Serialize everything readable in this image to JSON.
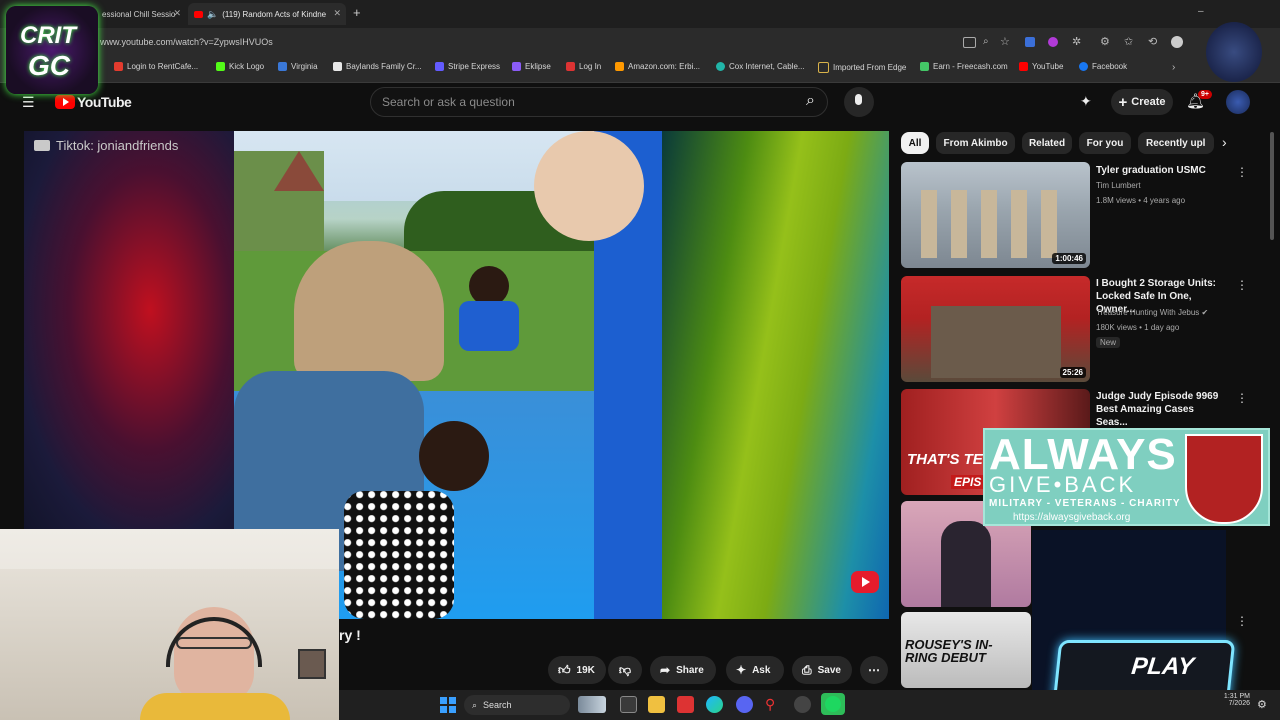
{
  "browser": {
    "tabs": [
      {
        "label": "essional Chill Sessio"
      },
      {
        "label": "(119) Random Acts of Kindne"
      }
    ],
    "new_tab": "+",
    "url": "www.youtube.com/watch?v=ZypwsIHVUOs",
    "bookmarks": [
      {
        "label": "Login to RentCafe...",
        "color": "#e33b2e"
      },
      {
        "label": "Kick Logo",
        "color": "#53fc18"
      },
      {
        "label": "Virginia",
        "color": "#3a78d8"
      },
      {
        "label": "Baylands Family Cr...",
        "color": "#e8e8e8"
      },
      {
        "label": "Stripe Express",
        "color": "#635bff"
      },
      {
        "label": "Eklipse",
        "color": "#8b5cf6"
      },
      {
        "label": "Log In",
        "color": "#d33"
      },
      {
        "label": "Amazon.com: Erbi...",
        "color": "#ff9900"
      },
      {
        "label": "Cox Internet, Cable...",
        "color": "#21b5a8"
      },
      {
        "label": "Imported From Edge",
        "color": "#d9b34a"
      },
      {
        "label": "Earn - Freecash.com",
        "color": "#44c767"
      },
      {
        "label": "YouTube",
        "color": "#ff0000"
      },
      {
        "label": "Facebook",
        "color": "#1877f2"
      }
    ]
  },
  "youtube": {
    "logo": "YouTube",
    "search_placeholder": "Search or ask a question",
    "create_label": "Create",
    "notif_count": "9+",
    "tiktok_label": "Tiktok: joniandfriends",
    "title_fragment": "ry !",
    "actions": {
      "likes": "19K",
      "share": "Share",
      "ask": "Ask",
      "save": "Save"
    }
  },
  "chips": [
    {
      "label": "All",
      "active": true
    },
    {
      "label": "From Akimbo"
    },
    {
      "label": "Related"
    },
    {
      "label": "For you"
    },
    {
      "label": "Recently upl"
    }
  ],
  "recommendations": [
    {
      "title": "Tyler graduation USMC",
      "channel": "Tim Lumbert",
      "stats": "1.8M views • 4 years ago",
      "duration": "1:00:46"
    },
    {
      "title": "I Bought 2 Storage Units: Locked Safe In One, Owner...",
      "channel": "Treasure Hunting With Jebus",
      "stats": "180K views • 1 day ago",
      "badge": "New",
      "duration": "25:26"
    },
    {
      "title": "Judge Judy Episode 9969 Best Amazing Cases Seas...",
      "thumb_text": "THAT'S TERR",
      "thumb_text2": "EPIS"
    },
    {
      "title": ""
    },
    {
      "title": "",
      "thumb_text": "ROUSEY'S IN-RING DEBUT"
    }
  ],
  "overlay": {
    "logo_line1": "CRIT",
    "logo_line2": "GC",
    "ad_line1": "ALWAYS",
    "ad_line2": "GIVE•BACK",
    "ad_line3": "MILITARY - VETERANS - CHARITY",
    "ad_url": "https://alwaysgiveback.org",
    "play_label": "PLAY"
  },
  "taskbar": {
    "search": "Search",
    "time": "1:31 PM",
    "date": "7/2026"
  }
}
